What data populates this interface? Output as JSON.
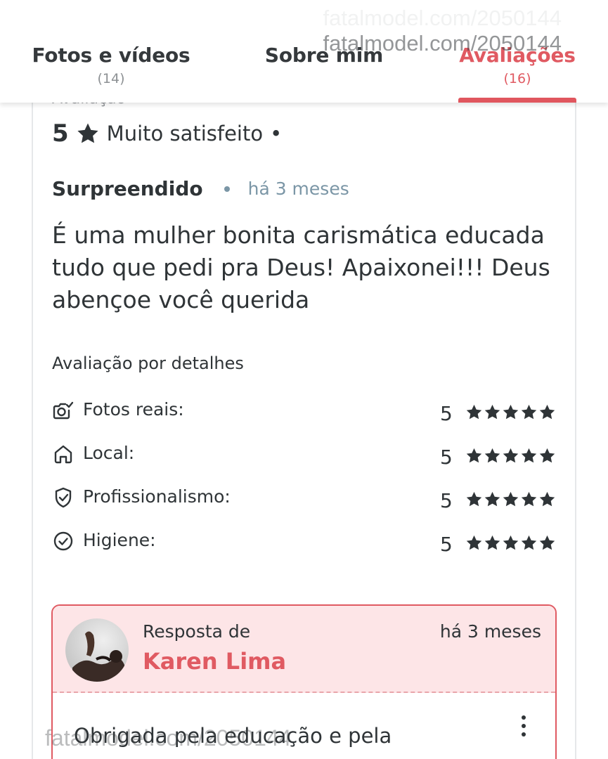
{
  "watermark": "fatalmodel.com/2050144",
  "watermark_bottom": "fatalmodel.com/2050144",
  "tabs": [
    {
      "label": "Fotos e vídeos",
      "count": "(14)"
    },
    {
      "label": "Sobre mim",
      "count": ""
    },
    {
      "label": "Avaliações",
      "count": "(16)",
      "active": true
    }
  ],
  "review": {
    "section_label": "Avaliação",
    "rating": "5",
    "rating_text": "Muito satisfeito",
    "rating_separator": "•",
    "title": "Surpreendido",
    "time": "há 3 meses",
    "body": "É uma mulher bonita carismática educada tudo que pedi pra Deus! Apaixonei!!! Deus abençoe você querida"
  },
  "details": {
    "title": "Avaliação por detalhes",
    "items": [
      {
        "label": "Fotos reais:",
        "score": "5",
        "stars": 5,
        "icon": "camera-check-icon"
      },
      {
        "label": "Local:",
        "score": "5",
        "stars": 5,
        "icon": "home-icon"
      },
      {
        "label": "Profissionalismo:",
        "score": "5",
        "stars": 5,
        "icon": "shield-check-icon"
      },
      {
        "label": "Higiene:",
        "score": "5",
        "stars": 5,
        "icon": "circle-check-icon"
      }
    ]
  },
  "reply": {
    "from_label": "Resposta de",
    "name": "Karen Lima",
    "time": "há 3 meses",
    "text": "Obrigada pela educação e pela"
  },
  "colors": {
    "accent": "#e05a62",
    "text": "#2f3437",
    "muted": "#7b96a6",
    "reply_bg": "#fde5e7"
  }
}
